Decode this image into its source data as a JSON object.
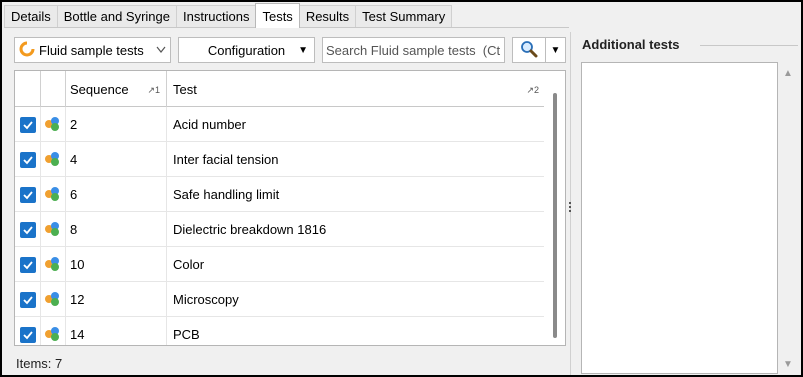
{
  "tabs": [
    {
      "label": "Details"
    },
    {
      "label": "Bottle and Syringe"
    },
    {
      "label": "Instructions"
    },
    {
      "label": "Tests",
      "active": true
    },
    {
      "label": "Results"
    },
    {
      "label": "Test Summary"
    }
  ],
  "toolbar": {
    "sample_type": "Fluid sample tests",
    "configuration_label": "Configuration",
    "search_placeholder": "Search Fluid sample tests  (Ct"
  },
  "grid": {
    "columns": [
      {
        "label": "",
        "icon": "checkbox-column"
      },
      {
        "label": "",
        "icon": "test-type-column"
      },
      {
        "label": "Sequence",
        "sort": "↗1"
      },
      {
        "label": "Test",
        "sort": "↗2"
      }
    ],
    "rows": [
      {
        "checked": true,
        "sequence": "2",
        "test": "Acid number"
      },
      {
        "checked": true,
        "sequence": "4",
        "test": "Inter facial tension"
      },
      {
        "checked": true,
        "sequence": "6",
        "test": "Safe handling limit"
      },
      {
        "checked": true,
        "sequence": "8",
        "test": "Dielectric breakdown 1816"
      },
      {
        "checked": true,
        "sequence": "10",
        "test": "Color"
      },
      {
        "checked": true,
        "sequence": "12",
        "test": "Microscopy"
      },
      {
        "checked": true,
        "sequence": "14",
        "test": "PCB"
      }
    ],
    "items_label": "Items: 7"
  },
  "additional_tests": {
    "title": "Additional tests",
    "items": []
  },
  "colors": {
    "checkbox": "#1a73c9",
    "tab_active_bg": "#ffffff",
    "panel_bg": "#f0f0f0"
  }
}
